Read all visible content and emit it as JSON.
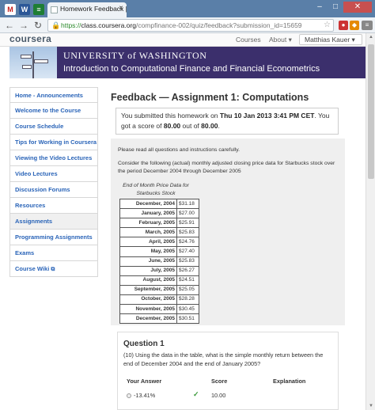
{
  "browser": {
    "pinned_tabs": [
      {
        "name": "gmail",
        "glyph": "M"
      },
      {
        "name": "word",
        "glyph": "W"
      },
      {
        "name": "sheets",
        "glyph": "≡"
      }
    ],
    "active_tab_title": "Homework Feedback | Int",
    "url_scheme": "https://",
    "url_host": "class.coursera.org",
    "url_path": "/compfinance-002/quiz/feedback?submission_id=15659",
    "window_controls": [
      "–",
      "□",
      "✕"
    ]
  },
  "coursera": {
    "logo": "coursera",
    "nav": [
      "Courses",
      "About ▾"
    ],
    "user": "Matthias Kauer ▾"
  },
  "banner": {
    "university": "UNIVERSITY of WASHINGTON",
    "course_title": "Introduction to Computational Finance and Financial Econometrics"
  },
  "sidebar": {
    "items": [
      {
        "label": "Home - Announcements",
        "active": false
      },
      {
        "label": "Welcome to the Course",
        "active": false
      },
      {
        "label": "Course Schedule",
        "active": false
      },
      {
        "label": "Tips for Working in Coursera",
        "active": false
      },
      {
        "label": "Viewing the Video Lectures",
        "active": false
      },
      {
        "label": "Video Lectures",
        "active": false
      },
      {
        "label": "Discussion Forums",
        "active": false
      },
      {
        "label": "Resources",
        "active": false
      },
      {
        "label": "Assignments",
        "active": true
      },
      {
        "label": "Programming Assignments",
        "active": false
      },
      {
        "label": "Exams",
        "active": false
      },
      {
        "label": "Course Wiki",
        "active": false,
        "external": true
      }
    ]
  },
  "main": {
    "title": "Feedback — Assignment 1: Computations",
    "notice_pre": "You submitted this homework on ",
    "notice_date": "Thu 10 Jan 2013 3:41 PM CET",
    "notice_mid": ". You got a score of ",
    "notice_score": "80.00",
    "notice_of": " out of ",
    "notice_total": "80.00",
    "notice_end": ".",
    "intro": "Please read all questions and instructions carefully.",
    "context": "Consider the following (actual) monthly adjusted closing price data for Starbucks stock over the period December 2004 through December 2005",
    "table_caption": "End of Month Price Data for Starbucks Stock",
    "prices": [
      {
        "date": "December, 2004",
        "price": "$31.18"
      },
      {
        "date": "January, 2005",
        "price": "$27.00"
      },
      {
        "date": "February, 2005",
        "price": "$25.91"
      },
      {
        "date": "March, 2005",
        "price": "$25.83"
      },
      {
        "date": "April, 2005",
        "price": "$24.76"
      },
      {
        "date": "May, 2005",
        "price": "$27.40"
      },
      {
        "date": "June, 2005",
        "price": "$25.83"
      },
      {
        "date": "July, 2005",
        "price": "$26.27"
      },
      {
        "date": "August, 2005",
        "price": "$24.51"
      },
      {
        "date": "September, 2005",
        "price": "$25.05"
      },
      {
        "date": "October, 2005",
        "price": "$28.28"
      },
      {
        "date": "November, 2005",
        "price": "$30.45"
      },
      {
        "date": "December, 2005",
        "price": "$30.51"
      }
    ]
  },
  "question1": {
    "title": "Question 1",
    "text": "(10) Using the data in the table, what is the simple monthly return between the end of December 2004 and the end of January 2005?",
    "headers": {
      "answer": "Your Answer",
      "score": "Score",
      "explanation": "Explanation"
    },
    "answer": "-13.41%",
    "check": "✓",
    "score": "10.00"
  },
  "colors": {
    "banner": "#3b2f6c",
    "link": "#2a64b8",
    "content_box": "#efefef"
  }
}
